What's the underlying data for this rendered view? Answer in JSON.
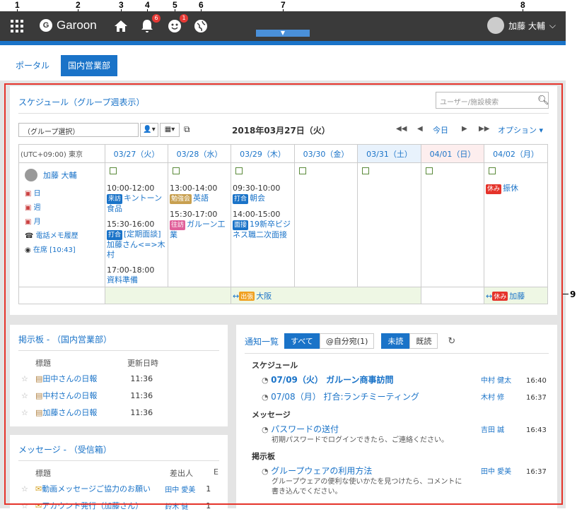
{
  "callouts": [
    "1",
    "2",
    "3",
    "4",
    "5",
    "6",
    "7",
    "8",
    "9"
  ],
  "header": {
    "app_name": "Garoon",
    "logo_letter": "G",
    "notif_badge": "6",
    "person_badge": "1",
    "user_name": "加藤 大輔"
  },
  "tabs": [
    "ポータル",
    "国内営業部"
  ],
  "schedule": {
    "title": "スケジュール（グループ週表示）",
    "search_placeholder": "ユーザー/施設検索",
    "group_select": "（グループ選択）",
    "date": "2018年03月27日（火）",
    "today": "今日",
    "options": "オプション",
    "tz": "(UTC+09:00) 東京",
    "days": [
      "03/27（火）",
      "03/28（水）",
      "03/29（木）",
      "03/30（金）",
      "03/31（土）",
      "04/01（日）",
      "04/02（月）"
    ],
    "user": "加藤 大輔",
    "user_links": [
      "日",
      "週",
      "月",
      "電話メモ履歴",
      "在席 [10:43]"
    ],
    "events_0": [
      {
        "time": "10:00-12:00",
        "tag": "来訪",
        "tag_color": "#1a73c8",
        "text": "キントーン食品"
      },
      {
        "time": "15:30-16:00",
        "tag": "打合",
        "tag_color": "#1a73c8",
        "text": "[定期面談]加藤さん<=>木村"
      },
      {
        "time": "17:00-18:00",
        "tag": "",
        "tag_color": "",
        "text": "資料準備"
      }
    ],
    "events_1": [
      {
        "time": "13:00-14:00",
        "tag": "勉強会",
        "tag_color": "#c8a050",
        "text": "英語"
      },
      {
        "time": "15:30-17:00",
        "tag": "往訪",
        "tag_color": "#e0609a",
        "text": "ガルーン工業"
      }
    ],
    "events_2": [
      {
        "time": "09:30-10:00",
        "tag": "打合",
        "tag_color": "#1a73c8",
        "text": "朝会"
      },
      {
        "time": "14:00-15:00",
        "tag": "面接",
        "tag_color": "#1a73c8",
        "text": "19新卒ビジネス職二次面接"
      }
    ],
    "events_6": [
      {
        "time": "",
        "tag": "休み",
        "tag_color": "#e5332a",
        "text": "振休"
      }
    ],
    "banner_trip_tag": "出張",
    "banner_trip_text": "大阪",
    "banner_off_tag": "休み",
    "banner_off_text": "加藤"
  },
  "board": {
    "title": "掲示板 - （国内営業部）",
    "col_title": "標題",
    "col_updated": "更新日時",
    "rows": [
      {
        "title": "田中さんの日報",
        "time": "11:36"
      },
      {
        "title": "中村さんの日報",
        "time": "11:36"
      },
      {
        "title": "加藤さんの日報",
        "time": "11:36"
      }
    ]
  },
  "messages": {
    "title": "メッセージ - （受信箱）",
    "col_title": "標題",
    "col_sender": "差出人",
    "col_e": "E",
    "rows": [
      {
        "title": "動画メッセージご協力のお願い",
        "sender": "田中 愛美",
        "n": "1"
      },
      {
        "title": "アカウント発行（加藤さん）",
        "sender": "鈴木 健",
        "n": "1"
      }
    ]
  },
  "notify": {
    "title": "通知一覧",
    "all": "すべて",
    "mine": "@自分宛(1)",
    "unread": "未読",
    "read": "既読",
    "sections": [
      {
        "name": "スケジュール",
        "items": [
          {
            "title": "07/09（火） ガルーン商事訪問",
            "bold": true,
            "user": "中村 健太",
            "time": "16:40",
            "desc": ""
          },
          {
            "title": "07/08（月） 打合:ランチミーティング",
            "bold": false,
            "user": "木村 修",
            "time": "16:37",
            "desc": ""
          }
        ]
      },
      {
        "name": "メッセージ",
        "items": [
          {
            "title": "パスワードの送付",
            "bold": false,
            "user": "吉田 誠",
            "time": "16:43",
            "desc": "初期パスワードでログインできたら、ご連絡ください。"
          }
        ]
      },
      {
        "name": "掲示板",
        "items": [
          {
            "title": "グループウェアの利用方法",
            "bold": false,
            "user": "田中 愛美",
            "time": "16:37",
            "desc": "グループウェアの便利な使いかたを見つけたら、コメントに書き込んでください。"
          }
        ]
      }
    ]
  }
}
